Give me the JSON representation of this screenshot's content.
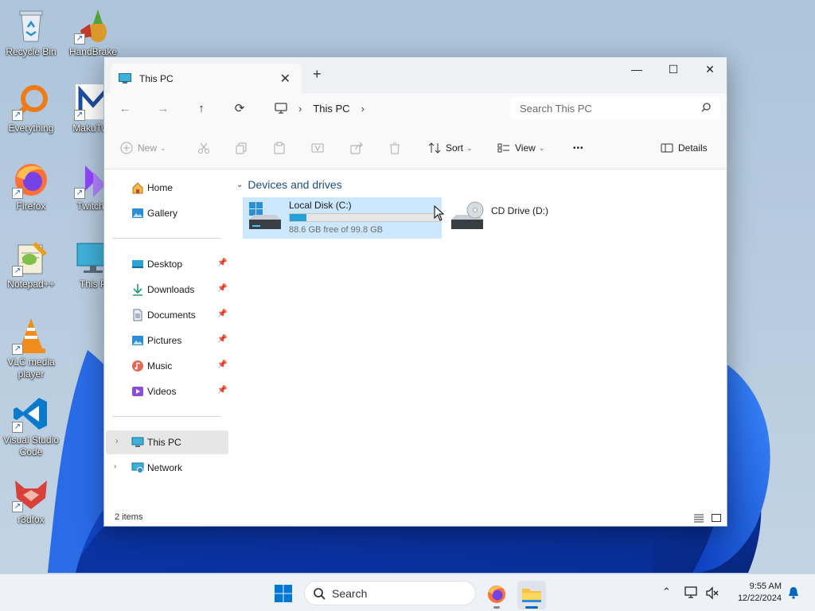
{
  "desktop": {
    "icons": [
      {
        "label": "Recycle Bin",
        "icon": "recycle-bin-icon"
      },
      {
        "label": "HandBrake",
        "icon": "handbrake-icon"
      },
      {
        "label": "Everything",
        "icon": "everything-search-icon"
      },
      {
        "label": "MakuTwe",
        "icon": "makutweaker-icon"
      },
      {
        "label": "Firefox",
        "icon": "firefox-icon"
      },
      {
        "label": "TwitchL",
        "icon": "twitch-icon"
      },
      {
        "label": "Notepad++",
        "icon": "notepadpp-icon"
      },
      {
        "label": "This P",
        "icon": "this-pc-icon"
      },
      {
        "label": "VLC media player",
        "icon": "vlc-icon"
      },
      {
        "label": "Visual Studio Code",
        "icon": "vscode-icon"
      },
      {
        "label": "r3dfox",
        "icon": "r3dfox-icon"
      }
    ]
  },
  "window": {
    "tab_title": "This PC",
    "tab_close": "✕",
    "new_tab": "+",
    "controls": {
      "minimize": "—",
      "maximize": "☐",
      "close": "✕"
    },
    "breadcrumb": {
      "location": "This PC"
    },
    "search": {
      "placeholder": "Search This PC"
    },
    "toolbar": {
      "new": "New",
      "sort": "Sort",
      "view": "View",
      "more": "•••",
      "details": "Details"
    },
    "nav": {
      "quick": [
        {
          "label": "Home",
          "icon": "home-icon"
        },
        {
          "label": "Gallery",
          "icon": "gallery-icon"
        }
      ],
      "pinned": [
        {
          "label": "Desktop",
          "icon": "desktop-folder-icon"
        },
        {
          "label": "Downloads",
          "icon": "downloads-icon"
        },
        {
          "label": "Documents",
          "icon": "documents-icon"
        },
        {
          "label": "Pictures",
          "icon": "pictures-icon"
        },
        {
          "label": "Music",
          "icon": "music-icon"
        },
        {
          "label": "Videos",
          "icon": "videos-icon"
        }
      ],
      "roots": [
        {
          "label": "This PC",
          "icon": "this-pc-icon",
          "selected": true
        },
        {
          "label": "Network",
          "icon": "network-icon",
          "selected": false
        }
      ]
    },
    "content": {
      "group_header": "Devices and drives",
      "drives": [
        {
          "name": "Local Disk (C:)",
          "free_text": "88.6 GB free of 99.8 GB",
          "used_fraction": 0.112,
          "icon": "windows-drive-icon",
          "selected": true
        },
        {
          "name": "CD Drive (D:)",
          "icon": "cd-drive-icon",
          "selected": false
        }
      ]
    },
    "status": {
      "item_count": "2 items"
    }
  },
  "taskbar": {
    "search_label": "Search",
    "apps": [
      "firefox-icon",
      "file-explorer-icon"
    ],
    "clock": {
      "time": "9:55 AM",
      "date": "12/22/2024"
    }
  },
  "colors": {
    "accent": "#0067c0",
    "selection": "#cce8ff",
    "drive_bar": "#26a0da",
    "group_header": "#1c4e8a"
  }
}
